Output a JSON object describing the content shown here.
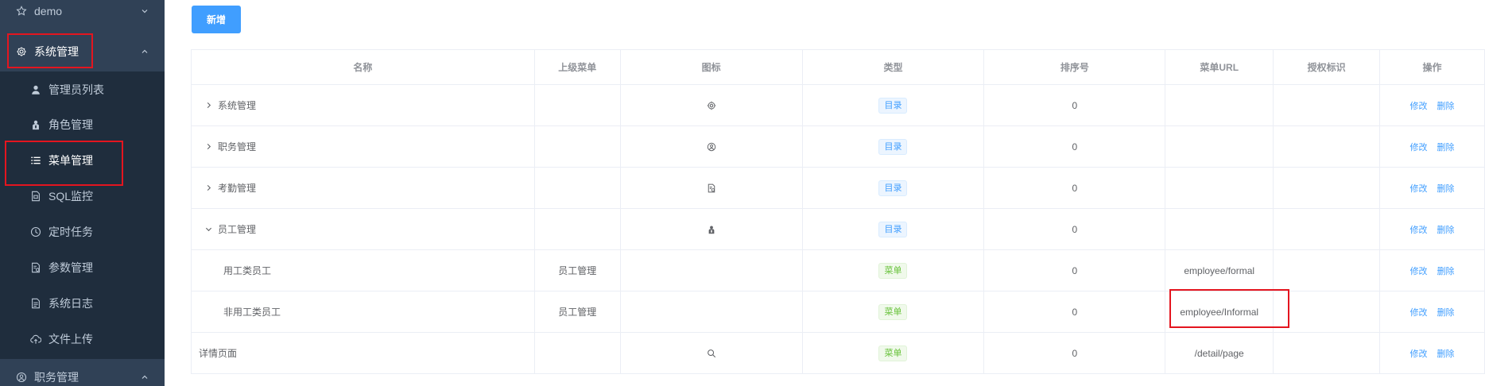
{
  "sidebar": {
    "items": [
      {
        "label": "demo",
        "icon": "star-icon"
      },
      {
        "label": "系统管理",
        "icon": "gear-icon"
      },
      {
        "label": "管理员列表",
        "icon": "user-icon"
      },
      {
        "label": "角色管理",
        "icon": "role-icon"
      },
      {
        "label": "菜单管理",
        "icon": "list-icon"
      },
      {
        "label": "SQL监控",
        "icon": "sql-doc-icon"
      },
      {
        "label": "定时任务",
        "icon": "clock-icon"
      },
      {
        "label": "参数管理",
        "icon": "param-doc-icon"
      },
      {
        "label": "系统日志",
        "icon": "log-doc-icon"
      },
      {
        "label": "文件上传",
        "icon": "cloud-upload-icon"
      },
      {
        "label": "职务管理",
        "icon": "job-icon"
      }
    ]
  },
  "toolbar": {
    "add_label": "新增"
  },
  "table": {
    "headers": [
      "名称",
      "上级菜单",
      "图标",
      "类型",
      "排序号",
      "菜单URL",
      "授权标识",
      "操作"
    ],
    "rows": [
      {
        "name": "系统管理",
        "parent": "",
        "type": "目录",
        "order": "0",
        "url": "",
        "perm": "",
        "edit": "修改",
        "delete": "删除"
      },
      {
        "name": "职务管理",
        "parent": "",
        "type": "目录",
        "order": "0",
        "url": "",
        "perm": "",
        "edit": "修改",
        "delete": "删除"
      },
      {
        "name": "考勤管理",
        "parent": "",
        "type": "目录",
        "order": "0",
        "url": "",
        "perm": "",
        "edit": "修改",
        "delete": "删除"
      },
      {
        "name": "员工管理",
        "parent": "",
        "type": "目录",
        "order": "0",
        "url": "",
        "perm": "",
        "edit": "修改",
        "delete": "删除"
      },
      {
        "name": "用工类员工",
        "parent": "员工管理",
        "type": "菜单",
        "order": "0",
        "url": "employee/formal",
        "perm": "",
        "edit": "修改",
        "delete": "删除"
      },
      {
        "name": "非用工类员工",
        "parent": "员工管理",
        "type": "菜单",
        "order": "0",
        "url": "employee/Informal",
        "perm": "",
        "edit": "修改",
        "delete": "删除"
      },
      {
        "name": "详情页面",
        "parent": "",
        "type": "菜单",
        "order": "0",
        "url": "/detail/page",
        "perm": "",
        "edit": "修改",
        "delete": "删除"
      }
    ]
  },
  "colors": {
    "sidebar_bg": "#304156",
    "submenu_bg": "#1f2d3d",
    "primary": "#409eff",
    "success": "#67c23a",
    "highlight_box": "#e4151f"
  }
}
